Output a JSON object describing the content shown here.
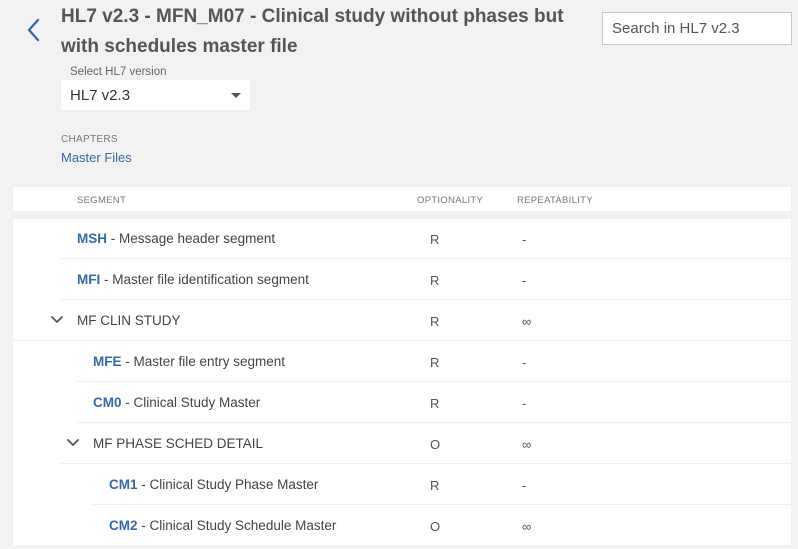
{
  "header": {
    "title": "HL7 v2.3 - MFN_M07 - Clinical study without phases but with schedules master file",
    "search_placeholder": "Search in HL7 v2.3"
  },
  "version": {
    "label": "Select HL7 version",
    "selected": "HL7 v2.3"
  },
  "chapters": {
    "label": "CHAPTERS",
    "link": "Master Files"
  },
  "table": {
    "columns": [
      "SEGMENT",
      "OPTIONALITY",
      "REPEATABILITY"
    ],
    "rows": [
      {
        "code": "MSH",
        "name": " - Message header segment",
        "opt": "R",
        "rep": "-"
      },
      {
        "code": "MFI",
        "name": " - Master file identification segment",
        "opt": "R",
        "rep": "-"
      },
      {
        "code": "",
        "name": "MF CLIN STUDY",
        "opt": "R",
        "rep": "∞"
      },
      {
        "code": "MFE",
        "name": " - Master file entry segment",
        "opt": "R",
        "rep": "-"
      },
      {
        "code": "CM0",
        "name": " - Clinical Study Master",
        "opt": "R",
        "rep": "-"
      },
      {
        "code": "",
        "name": "MF PHASE SCHED DETAIL",
        "opt": "O",
        "rep": "∞"
      },
      {
        "code": "CM1",
        "name": " - Clinical Study Phase Master",
        "opt": "R",
        "rep": "-"
      },
      {
        "code": "CM2",
        "name": " - Clinical Study Schedule Master",
        "opt": "O",
        "rep": "∞"
      }
    ]
  }
}
